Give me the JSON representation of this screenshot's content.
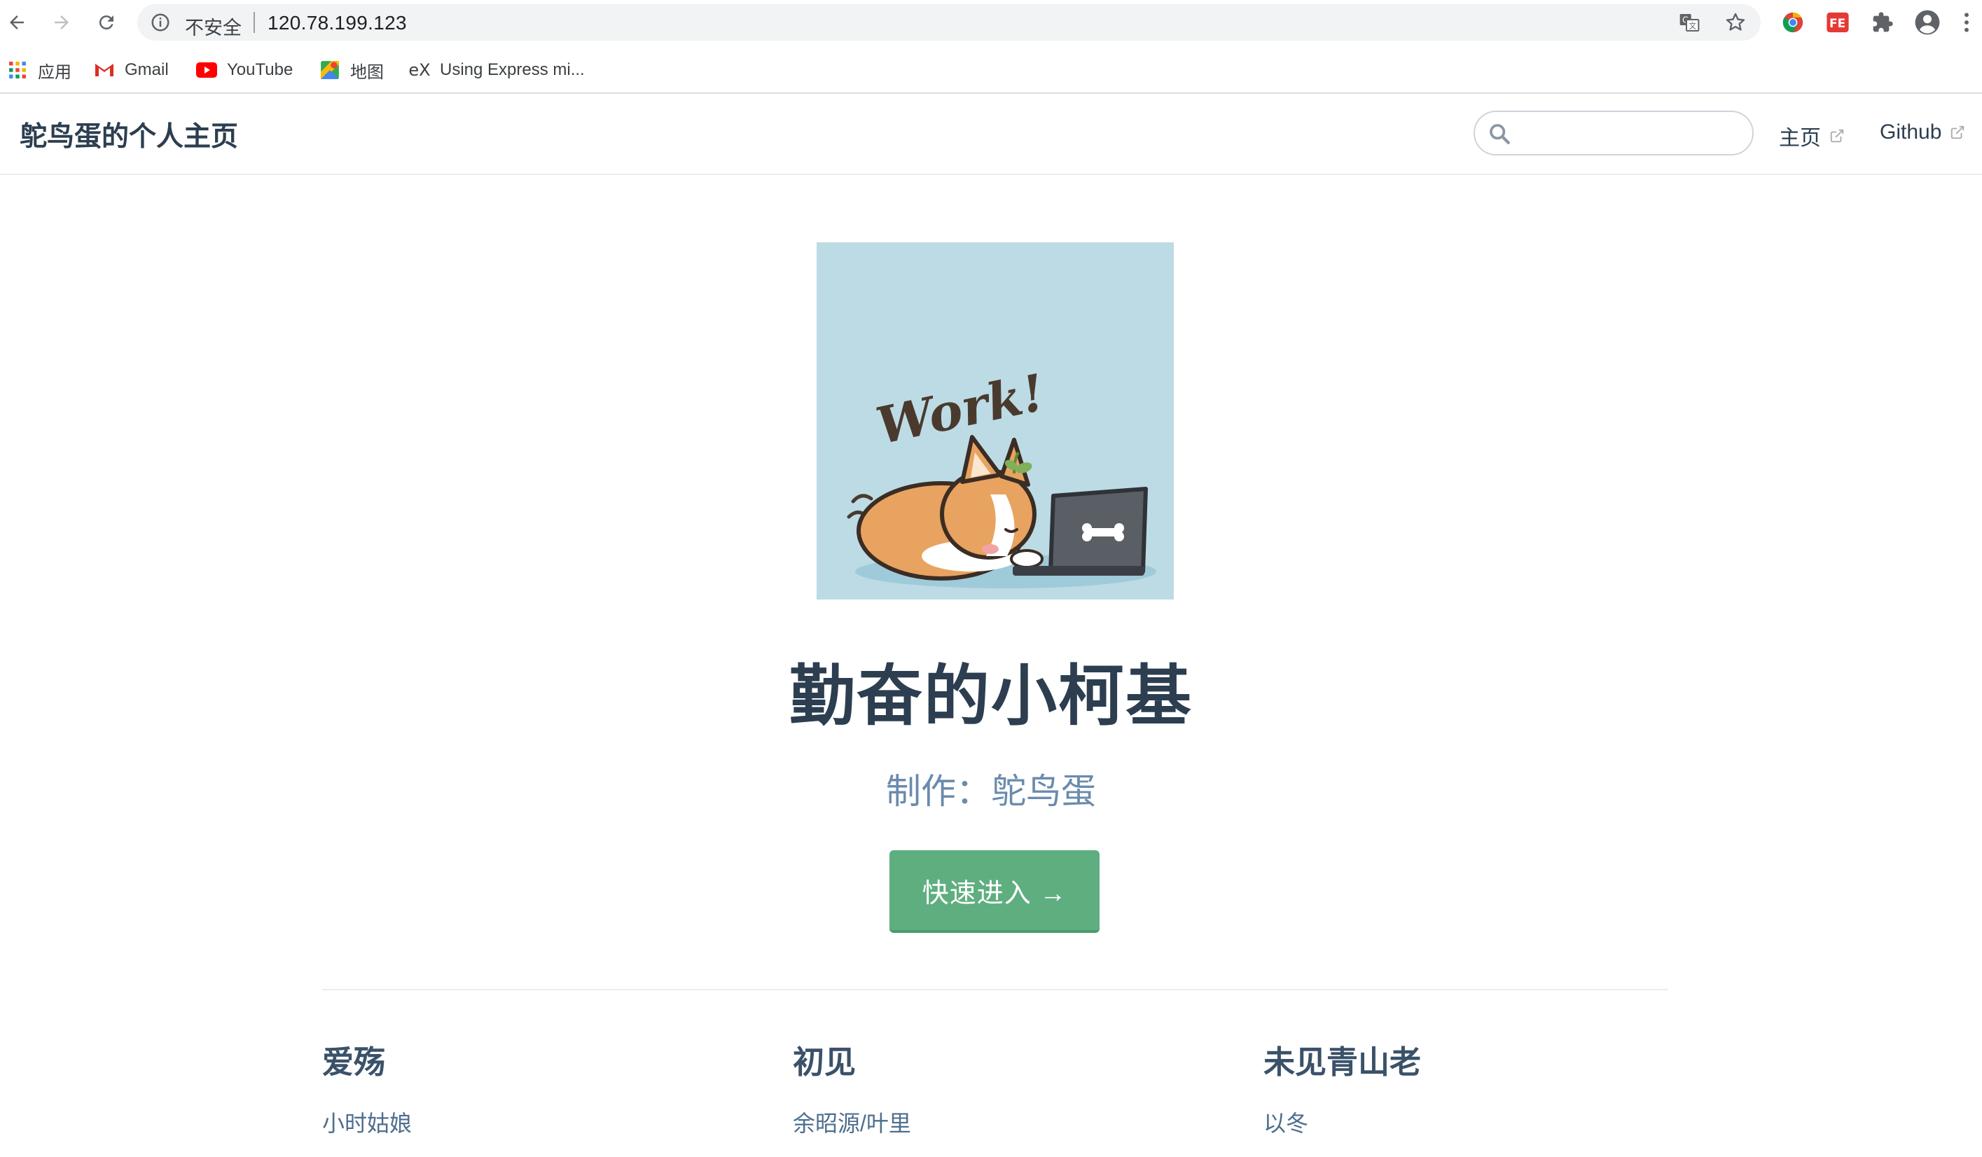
{
  "browser": {
    "insecure_label": "不安全",
    "url": "120.78.199.123",
    "bookmarks": [
      {
        "label": "应用",
        "icon": "apps-grid-icon"
      },
      {
        "label": "Gmail",
        "icon": "gmail-icon"
      },
      {
        "label": "YouTube",
        "icon": "youtube-icon"
      },
      {
        "label": "地图",
        "icon": "maps-icon"
      },
      {
        "label": "Using Express mi...",
        "icon": "express-icon"
      }
    ],
    "colors": {
      "toolbar_bg": "#ffffff",
      "omnibox_bg": "#f1f3f4"
    }
  },
  "navbar": {
    "site_title": "鸵鸟蛋的个人主页",
    "search_value": "",
    "links": [
      {
        "label": "主页"
      },
      {
        "label": "Github"
      }
    ]
  },
  "hero": {
    "image_text": "Work!",
    "title": "勤奋的小柯基",
    "description": "制作：鸵鸟蛋",
    "action_label": "快速进入 →",
    "accent_color": "#5fae80"
  },
  "features": [
    {
      "title": "爱殇",
      "details": "小时姑娘"
    },
    {
      "title": "初见",
      "details": "余昭源/叶里"
    },
    {
      "title": "未见青山老",
      "details": "以冬"
    }
  ]
}
